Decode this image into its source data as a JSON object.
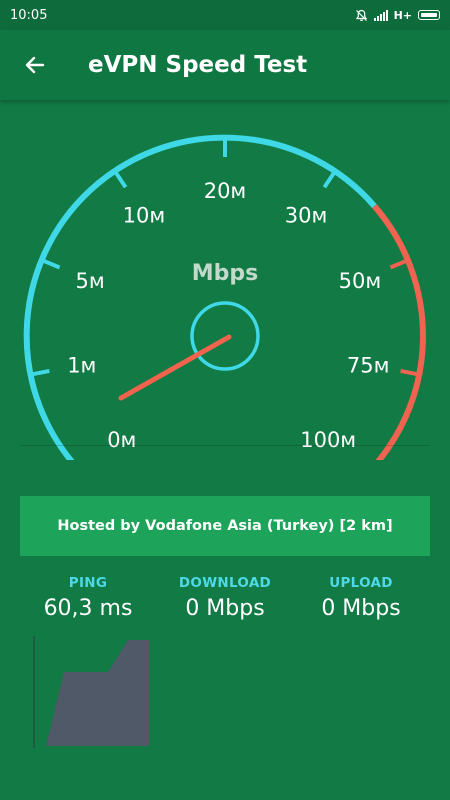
{
  "status_bar": {
    "time": "10:05",
    "network": "H+",
    "icons": [
      "alarm-muted-icon",
      "signal-icon",
      "battery-icon"
    ]
  },
  "header": {
    "title": "eVPN Speed Test",
    "back_icon": "arrow-left-icon"
  },
  "gauge": {
    "unit": "Mbps",
    "ticks": [
      "0м",
      "1м",
      "5м",
      "10м",
      "20м",
      "30м",
      "50м",
      "75м",
      "100м"
    ],
    "needle_value": "0м",
    "colors": {
      "normal": "#3fd8e6",
      "high": "#ef6350",
      "needle": "#f2634e"
    }
  },
  "host": {
    "text": "Hosted by Vodafone Asia (Turkey) [2 km]"
  },
  "metrics": [
    {
      "label": "PING",
      "value": "60,3 ms"
    },
    {
      "label": "DOWNLOAD",
      "value": "0 Mbps"
    },
    {
      "label": "UPLOAD",
      "value": "0 Mbps"
    }
  ],
  "colors": {
    "background": "#117a45",
    "app_bar": "#0f7741",
    "banner": "#1ea35a",
    "label_accent": "#4fd9e6",
    "graph_fill": "#4f5968"
  }
}
